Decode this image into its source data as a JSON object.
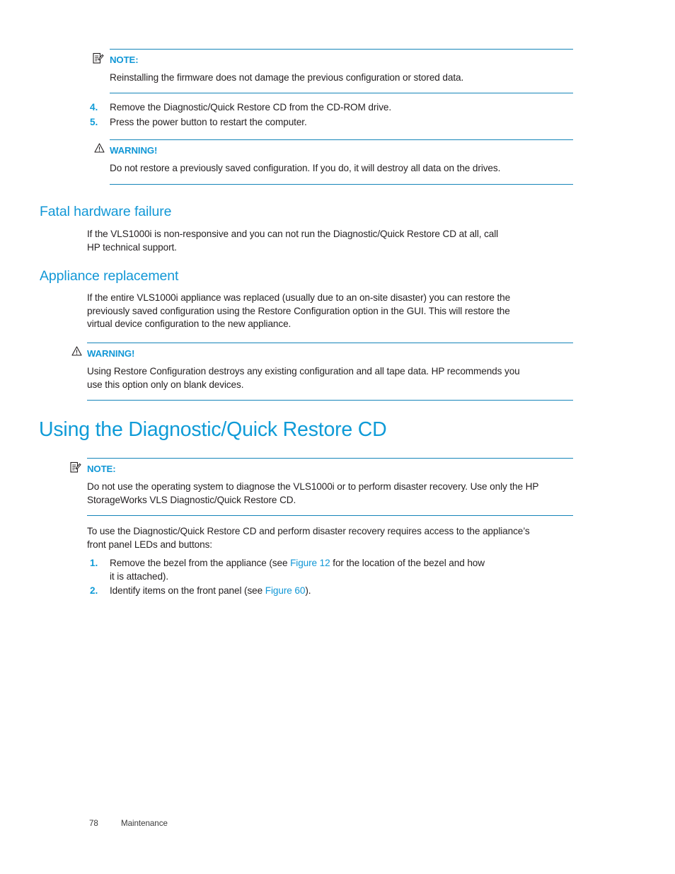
{
  "document": {
    "footer": {
      "page_number": "78",
      "chapter_label": "Maintenance"
    },
    "colors": {
      "heading_blue": "#0f9bd7",
      "accent_blue": "#1197d6",
      "rule_blue": "#1585b9",
      "body_text": "#231f20"
    }
  },
  "note_firmware": {
    "icon": "note-icon",
    "label": "NOTE:",
    "body": "Reinstalling the firmware does not damage the previous configuration or stored data."
  },
  "steps_restore": [
    {
      "number": "4.",
      "text": "Remove the Diagnostic/Quick Restore CD from the CD-ROM drive."
    },
    {
      "number": "5.",
      "text": "Press the power button to restart the computer."
    }
  ],
  "warning_restore": {
    "icon": "warning-triangle-icon",
    "label": "WARNING!",
    "body": "Do not restore a previously saved configuration. If you do, it will destroy all data on the drives."
  },
  "section_fatal": {
    "title": "Fatal hardware failure",
    "body_line_1": "If the VLS1000i is non-responsive and you can not run the Diagnostic/Quick Restore CD at all, call",
    "body_line_2": "HP technical support."
  },
  "section_appliance": {
    "title": "Appliance replacement",
    "body_line_1": "If the entire VLS1000i appliance was replaced (usually due to an on-site disaster) you can restore the",
    "body_line_2": "previously saved configuration using the Restore Configuration option in the GUI. This will restore the",
    "body_line_3": "virtual device configuration to the new appliance."
  },
  "warning_reconfig": {
    "icon": "warning-triangle-icon",
    "label": "WARNING!",
    "body_line_1": "Using Restore Configuration destroys any existing configuration and all tape data. HP recommends you",
    "body_line_2": "use this option only on blank devices."
  },
  "chapter": {
    "title": "Using the Diagnostic/Quick Restore CD"
  },
  "note_diagnose": {
    "icon": "note-icon",
    "label": "NOTE:",
    "body_line_1": "Do not use the operating system to diagnose the VLS1000i or to perform disaster recovery. Use only the HP",
    "body_line_2": "StorageWorks VLS Diagnostic/Quick Restore CD."
  },
  "intro": {
    "line_1": "To use the Diagnostic/Quick Restore CD and perform disaster recovery requires access to the appliance’s",
    "line_2": "front panel LEDs and buttons:"
  },
  "steps_procedure": [
    {
      "number": "1.",
      "pre": "Remove the bezel from the appliance (see ",
      "xref": "Figure 12",
      "post": " for the location of the bezel and how",
      "line_2": "it is attached)."
    },
    {
      "number": "2.",
      "pre": "Identify items on the front panel (see ",
      "xref": "Figure 60",
      "post": ").",
      "line_2": ""
    }
  ]
}
